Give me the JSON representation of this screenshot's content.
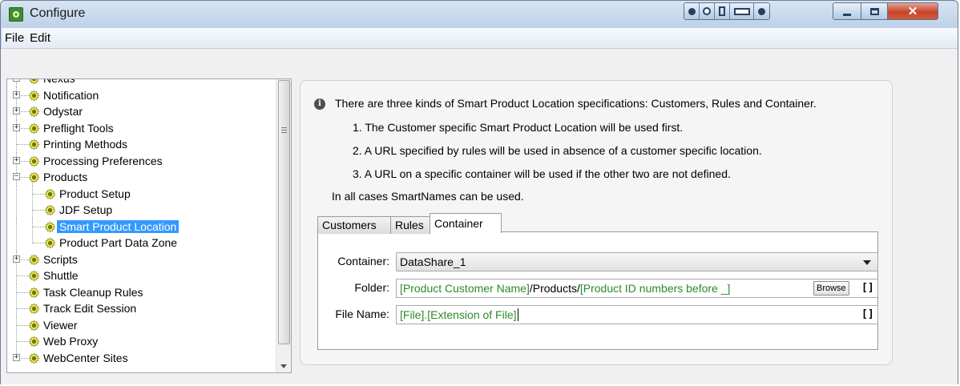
{
  "window": {
    "title": "Configure"
  },
  "menu": [
    "File",
    "Edit"
  ],
  "tree": {
    "items": [
      {
        "label": "Nexus",
        "level": 0,
        "expander": "+"
      },
      {
        "label": "Notification",
        "level": 0,
        "expander": "+"
      },
      {
        "label": "Odystar",
        "level": 0,
        "expander": "+"
      },
      {
        "label": "Preflight Tools",
        "level": 0,
        "expander": "+"
      },
      {
        "label": "Printing Methods",
        "level": 0,
        "expander": ""
      },
      {
        "label": "Processing Preferences",
        "level": 0,
        "expander": "+"
      },
      {
        "label": "Products",
        "level": 0,
        "expander": "-"
      },
      {
        "label": "Product Setup",
        "level": 1,
        "expander": ""
      },
      {
        "label": "JDF Setup",
        "level": 1,
        "expander": ""
      },
      {
        "label": "Smart Product Location",
        "level": 1,
        "expander": "",
        "selected": true
      },
      {
        "label": "Product Part Data Zone",
        "level": 1,
        "expander": ""
      },
      {
        "label": "Scripts",
        "level": 0,
        "expander": "+"
      },
      {
        "label": "Shuttle",
        "level": 0,
        "expander": ""
      },
      {
        "label": "Task Cleanup Rules",
        "level": 0,
        "expander": ""
      },
      {
        "label": "Track Edit Session",
        "level": 0,
        "expander": ""
      },
      {
        "label": "Viewer",
        "level": 0,
        "expander": ""
      },
      {
        "label": "Web Proxy",
        "level": 0,
        "expander": ""
      },
      {
        "label": "WebCenter Sites",
        "level": 0,
        "expander": "+"
      }
    ]
  },
  "info": {
    "intro": "There are three kinds of Smart Product Location specifications: Customers, Rules and Container.",
    "point1": "1. The Customer specific Smart Product Location will be used first.",
    "point2": "2. A URL specified by rules will be used in absence of a customer specific location.",
    "point3": "3. A URL on a specific container will be used if the other two are not defined.",
    "footer": "In all cases SmartNames can be used."
  },
  "tabs": [
    "Customers",
    "Rules",
    "Container"
  ],
  "form": {
    "container_label": "Container:",
    "container_value": "DataShare_1",
    "folder_label": "Folder:",
    "folder_part1": "[Product Customer Name]",
    "folder_part2": "/Products/",
    "folder_part3": "[Product ID numbers before _]",
    "browse_label": "Browse",
    "brackets_label": "[]",
    "filename_label": "File Name:",
    "filename_part1": "[File]",
    "filename_part2": ".",
    "filename_part3": "[Extension of File]"
  },
  "colors": {
    "smartname": "#2b8a2b",
    "selection": "#3399ff"
  }
}
